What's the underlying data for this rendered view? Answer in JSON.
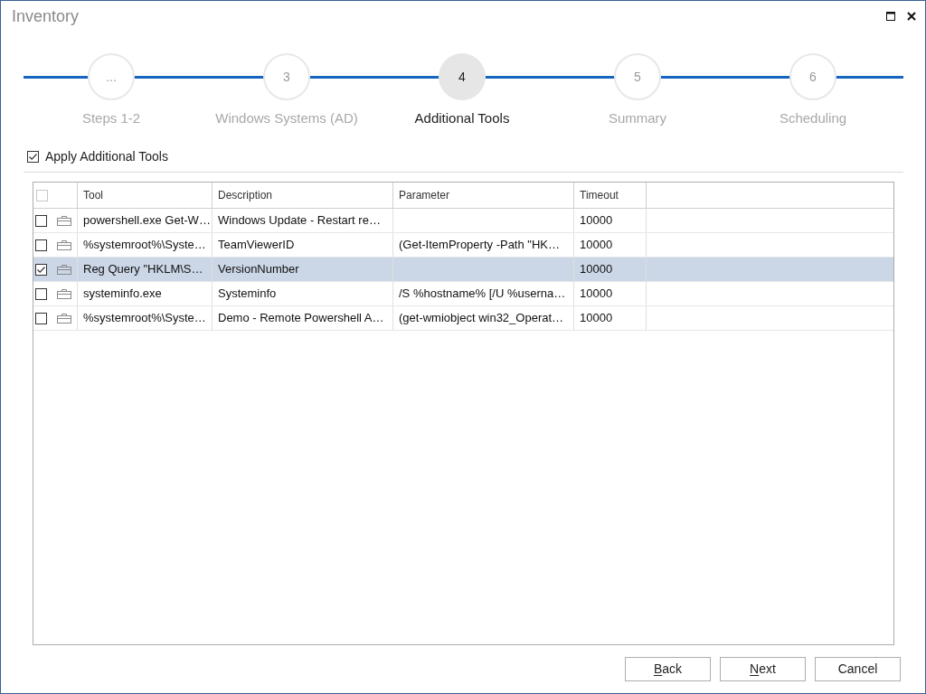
{
  "window": {
    "title": "Inventory"
  },
  "steps": [
    {
      "number": "...",
      "label": "Steps 1-2",
      "selected": false
    },
    {
      "number": "3",
      "label": "Windows Systems (AD)",
      "selected": false
    },
    {
      "number": "4",
      "label": "Additional Tools",
      "selected": true
    },
    {
      "number": "5",
      "label": "Summary",
      "selected": false
    },
    {
      "number": "6",
      "label": "Scheduling",
      "selected": false
    }
  ],
  "apply_option": {
    "label": "Apply Additional Tools",
    "checked": true
  },
  "table": {
    "header_checkbox": {
      "checked": false
    },
    "columns": [
      "Tool",
      "Description",
      "Parameter",
      "Timeout"
    ],
    "rows": [
      {
        "checked": false,
        "selected": false,
        "tool": "powershell.exe Get-W…",
        "description": "Windows Update - Restart re…",
        "timeout": "10000"
      },
      {
        "checked": false,
        "selected": false,
        "tool": "%systemroot%\\Syste…",
        "description": "TeamViewerID",
        "parameter": "(Get-ItemProperty -Path \"HK…",
        "timeout": "10000"
      },
      {
        "checked": true,
        "selected": true,
        "tool": "Reg Query \"HKLM\\S…",
        "description": "VersionNumber",
        "timeout": "10000"
      },
      {
        "checked": false,
        "selected": false,
        "tool": "systeminfo.exe",
        "description": "Systeminfo",
        "parameter": "/S %hostname% [/U %userna…",
        "timeout": "10000"
      },
      {
        "checked": false,
        "selected": false,
        "tool": "%systemroot%\\Syste…",
        "description": "Demo - Remote Powershell A…",
        "parameter": "(get-wmiobject win32_Operat…",
        "timeout": "10000"
      }
    ]
  },
  "buttons": [
    {
      "label": "Back",
      "access_key": true
    },
    {
      "label": "Next",
      "access_key": true
    },
    {
      "label": "Cancel",
      "access_key": false
    }
  ]
}
